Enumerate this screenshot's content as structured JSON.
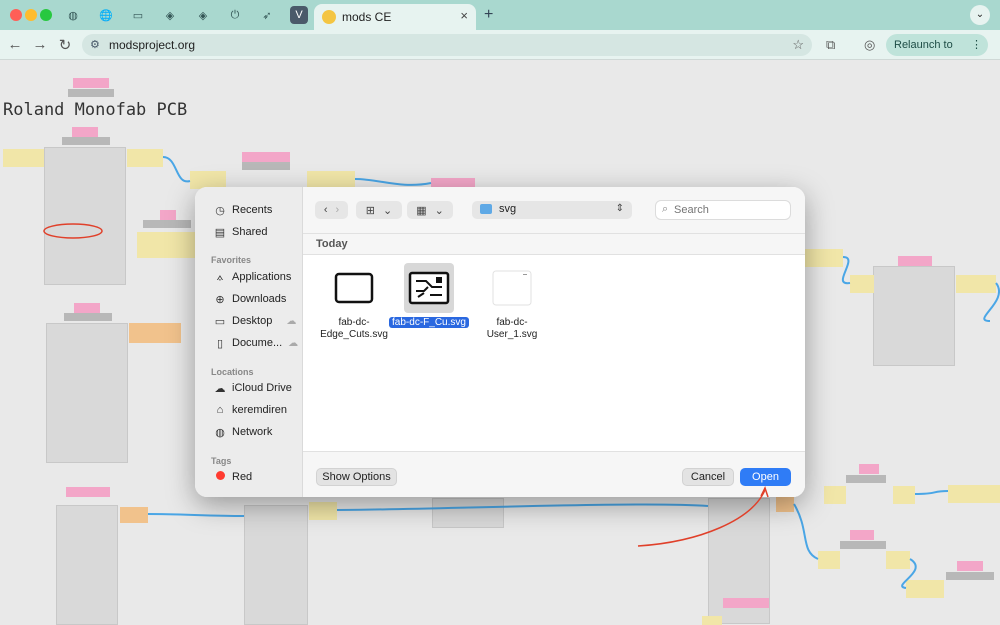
{
  "browser": {
    "tab_title": "mods CE",
    "url": "modsproject.org",
    "relaunch_label": "Relaunch to update",
    "inactive_tabs": [
      "globe-icon",
      "book-icon",
      "box-icon",
      "cube-icon",
      "power-icon",
      "rocket-icon",
      "v-icon"
    ]
  },
  "canvas": {
    "title": "Roland Monofab PCB"
  },
  "dialog": {
    "sidebar": {
      "items": [
        {
          "label": "Recents",
          "icon": "clock-icon"
        },
        {
          "label": "Shared",
          "icon": "shared-folder-icon"
        }
      ],
      "favorites_heading": "Favorites",
      "favorites": [
        {
          "label": "Applications",
          "icon": "applications-icon"
        },
        {
          "label": "Downloads",
          "icon": "download-icon"
        },
        {
          "label": "Desktop",
          "icon": "desktop-icon"
        },
        {
          "label": "Docume...",
          "icon": "document-icon"
        }
      ],
      "locations_heading": "Locations",
      "locations": [
        {
          "label": "iCloud Drive",
          "icon": "cloud-icon"
        },
        {
          "label": "keremdiren",
          "icon": "home-icon"
        },
        {
          "label": "Network",
          "icon": "globe-icon"
        }
      ],
      "tags_heading": "Tags",
      "tags": [
        {
          "label": "Red",
          "color": "#ff3b30"
        }
      ]
    },
    "path": "svg",
    "search_placeholder": "Search",
    "section": "Today",
    "files": [
      {
        "name_line1": "fab-dc-",
        "name_line2": "Edge_Cuts.svg",
        "selected": false
      },
      {
        "name_line1": "fab-dc-F_Cu.svg",
        "name_line2": "",
        "selected": true
      },
      {
        "name_line1": "fab-dc-",
        "name_line2": "User_1.svg",
        "selected": false
      }
    ],
    "show_options_label": "Show Options",
    "cancel_label": "Cancel",
    "open_label": "Open"
  },
  "colors": {
    "tabbar": "#a9d8cf",
    "accent_blue": "#2f7cf6",
    "selection_blue": "#2a68e0",
    "annotation_red": "#e0402a"
  }
}
